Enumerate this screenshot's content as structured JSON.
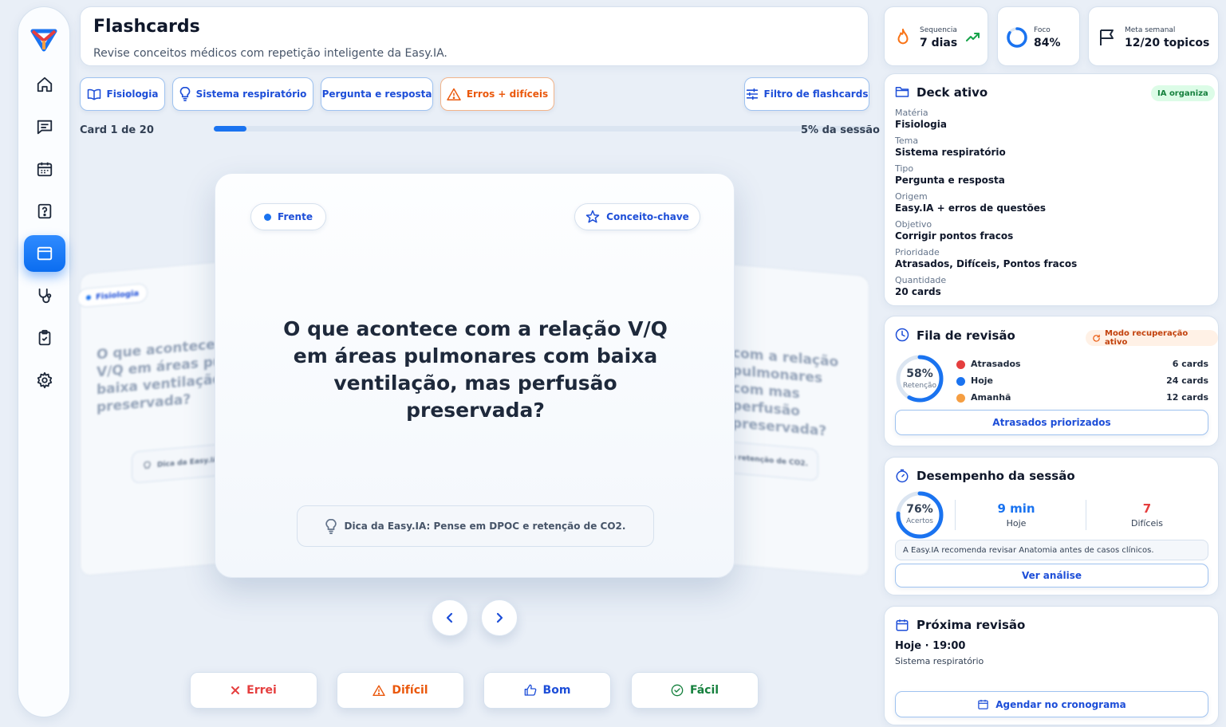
{
  "nav": {
    "items": [
      {
        "icon": "home-icon",
        "active": false
      },
      {
        "icon": "chat-icon",
        "active": false
      },
      {
        "icon": "calendar-icon",
        "active": false
      },
      {
        "icon": "question-icon",
        "active": false
      },
      {
        "icon": "flashcards-icon",
        "active": true
      },
      {
        "icon": "stethoscope-icon",
        "active": false
      },
      {
        "icon": "clipboard-check-icon",
        "active": false
      },
      {
        "icon": "settings-icon",
        "active": false
      }
    ]
  },
  "header": {
    "title": "Flashcards",
    "subtitle": "Revise conceitos médicos com repetição inteligente da Easy.IA."
  },
  "stats": {
    "streak": {
      "label": "Sequencia",
      "value": "7 dias"
    },
    "focus": {
      "label": "Foco",
      "value": "84%",
      "percent": 84
    },
    "goal": {
      "label": "Meta semanal",
      "value": "12/20 topicos"
    }
  },
  "filters": {
    "subject": "Fisiologia",
    "topic": "Sistema respiratório",
    "type": "Pergunta e resposta",
    "mode": "Erros + difíceis",
    "filter_button": "Filtro de flashcards"
  },
  "session": {
    "card_label": "Card 1 de 20",
    "progress_label": "5% da sessão",
    "progress": 0.05
  },
  "card": {
    "side": "Frente",
    "tag": "Conceito-chave",
    "question": "O que acontece com a relação V/Q em áreas pulmonares com baixa ventilação, mas perfusão preservada?",
    "hint": "Dica da Easy.IA: Pense em DPOC e retenção de CO2."
  },
  "back_cards": {
    "left_tag": "Fisiologia",
    "left_text": "O que acontece com a relação V/Q em áreas pulmonares com baixa ventilação, mas perfusão preservada?",
    "left_hint": "Dica da Easy.IA:",
    "right_text": "com a relação pulmonares com mas perfusão preservada?",
    "right_hint": "C e retenção de CO2."
  },
  "answers": {
    "wrong": "Errei",
    "hard": "Difícil",
    "good": "Bom",
    "easy": "Fácil"
  },
  "deck": {
    "title": "Deck ativo",
    "badge": "IA organiza",
    "fields": [
      {
        "k": "Matéria",
        "v": "Fisiologia"
      },
      {
        "k": "Tema",
        "v": "Sistema respiratório"
      },
      {
        "k": "Tipo",
        "v": "Pergunta e resposta"
      },
      {
        "k": "Origem",
        "v": "Easy.IA + erros de questões"
      },
      {
        "k": "Objetivo",
        "v": "Corrigir pontos fracos"
      },
      {
        "k": "Prioridade",
        "v": "Atrasados, Difíceis, Pontos fracos"
      },
      {
        "k": "Quantidade",
        "v": "20 cards"
      }
    ]
  },
  "queue": {
    "title": "Fila de revisão",
    "badge": "Modo recuperação ativo",
    "retention_value": "58%",
    "retention_label": "Retenção",
    "retention_percent": 58,
    "rows": [
      {
        "name": "Atrasados",
        "count": "6 cards",
        "color": "#e53e3e"
      },
      {
        "name": "Hoje",
        "count": "24 cards",
        "color": "#1a73f0"
      },
      {
        "name": "Amanhã",
        "count": "12 cards",
        "color": "#f59e42"
      }
    ],
    "button": "Atrasados priorizados"
  },
  "performance": {
    "title": "Desempenho da sessão",
    "accuracy_value": "76%",
    "accuracy_label": "Acertos",
    "accuracy_percent": 76,
    "time_value": "9 min",
    "time_label": "Hoje",
    "hard_value": "7",
    "hard_label": "Difíceis",
    "recommendation": "A Easy.IA recomenda revisar Anatomia antes de casos clínicos.",
    "button": "Ver análise"
  },
  "next_review": {
    "title": "Próxima revisão",
    "time": "Hoje · 19:00",
    "topic": "Sistema respiratório",
    "button": "Agendar no cronograma"
  },
  "colors": {
    "accent": "#1a73f0",
    "danger": "#e53e3e",
    "warning": "#ea580c",
    "success": "#15803d"
  }
}
